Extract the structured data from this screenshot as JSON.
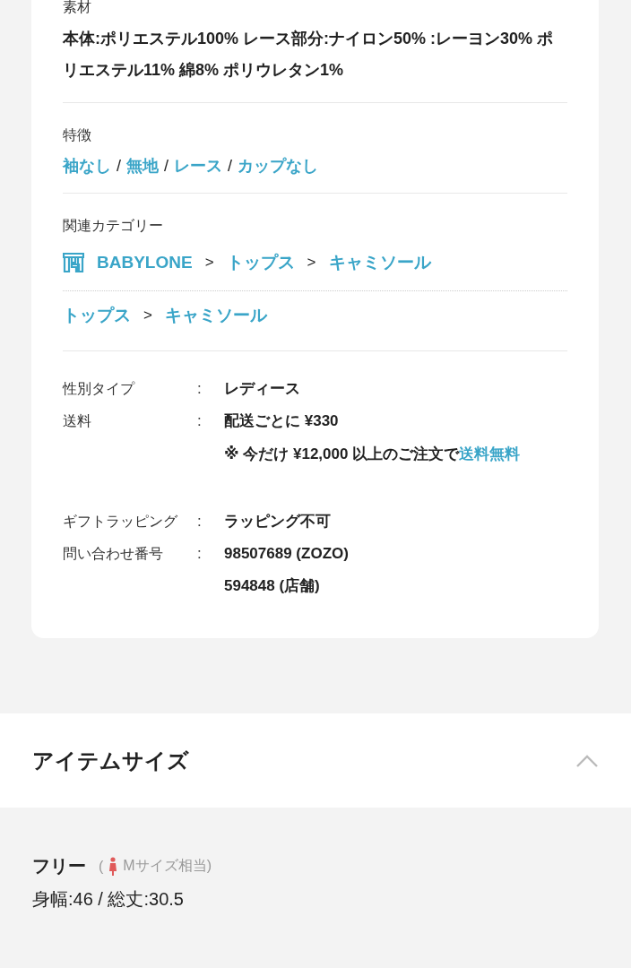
{
  "material": {
    "label": "素材",
    "value": "本体:ポリエステル100%  レース部分:ナイロン50%  :レーヨン30%  ポリエステル11%  綿8%  ポリウレタン1%"
  },
  "features": {
    "label": "特徴",
    "separator": "/",
    "tags": [
      "袖なし",
      "無地",
      "レース",
      "カップなし"
    ]
  },
  "related_categories": {
    "label": "関連カテゴリー",
    "separator": ">",
    "paths": [
      {
        "kind": "shop",
        "items": [
          "BABYLONE",
          "トップス",
          "キャミソール"
        ]
      },
      {
        "kind": "category",
        "items": [
          "トップス",
          "キャミソール"
        ]
      }
    ]
  },
  "details": {
    "separator": ":",
    "groups": [
      [
        {
          "label": "性別タイプ",
          "values": [
            {
              "kind": "text",
              "text": "レディース"
            }
          ]
        },
        {
          "label": "送料",
          "values": [
            {
              "kind": "text",
              "text": "配送ごとに ¥330"
            },
            {
              "kind": "note",
              "text": "※ 今だけ ¥12,000 以上のご注文で",
              "link": "送料無料"
            }
          ]
        }
      ],
      [
        {
          "label": "ギフトラッピング",
          "values": [
            {
              "kind": "text",
              "text": "ラッピング不可"
            }
          ]
        },
        {
          "label": "問い合わせ番号",
          "values": [
            {
              "kind": "text",
              "text": "98507689 (ZOZO)"
            },
            {
              "kind": "text",
              "text": "594848 (店舗)"
            }
          ]
        }
      ]
    ]
  },
  "item_size": {
    "title": "アイテムサイズ",
    "expanded": true,
    "sizes": [
      {
        "name": "フリー",
        "note_prefix": "(",
        "note": "Mサイズ相当)",
        "measurements": "身幅:46 / 総丈:30.5"
      }
    ]
  }
}
